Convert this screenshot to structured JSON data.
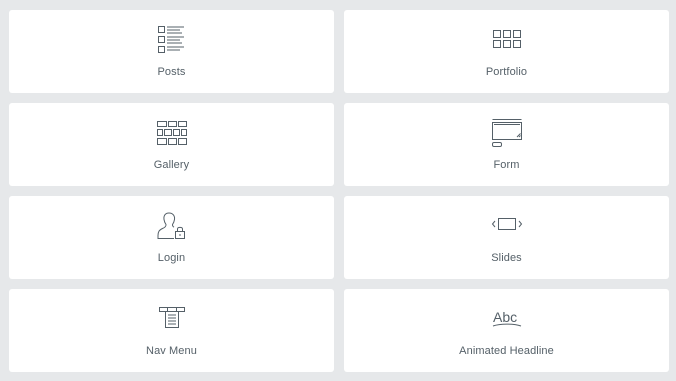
{
  "widgets": [
    {
      "label": "Posts",
      "icon": "posts-icon"
    },
    {
      "label": "Portfolio",
      "icon": "portfolio-icon"
    },
    {
      "label": "Gallery",
      "icon": "gallery-icon"
    },
    {
      "label": "Form",
      "icon": "form-icon"
    },
    {
      "label": "Login",
      "icon": "login-icon"
    },
    {
      "label": "Slides",
      "icon": "slides-icon"
    },
    {
      "label": "Nav Menu",
      "icon": "nav-menu-icon"
    },
    {
      "label": "Animated Headline",
      "icon": "animated-headline-icon",
      "icon_text": "Abc"
    }
  ],
  "colors": {
    "background": "#e6e8ea",
    "card": "#ffffff",
    "icon": "#556068",
    "label": "#556068"
  }
}
